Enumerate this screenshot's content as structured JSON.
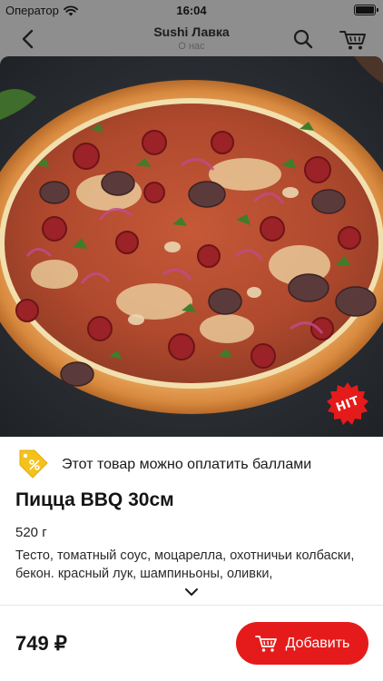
{
  "status_bar": {
    "carrier": "Оператор",
    "time": "16:04"
  },
  "nav": {
    "title": "Sushi Лавка",
    "subtitle": "О нас"
  },
  "product": {
    "badge": "HIT",
    "points_note": "Этот товар можно оплатить баллами",
    "title": "Пицца BBQ 30см",
    "weight": "520 г",
    "description": "Тесто, томатный соус, моцарелла, охотничьи колбаски, бекон. красный лук, шампиньоны, оливки,",
    "price": "749 ₽"
  },
  "actions": {
    "add_label": "Добавить"
  },
  "colors": {
    "accent": "#e51b1b",
    "points_badge": "#f4c21b",
    "backdrop": "#8e8e8e"
  },
  "icons": [
    "wifi-icon",
    "battery-icon",
    "back-chevron-icon",
    "search-icon",
    "cart-icon",
    "percent-tag-icon",
    "chevron-down-icon"
  ]
}
